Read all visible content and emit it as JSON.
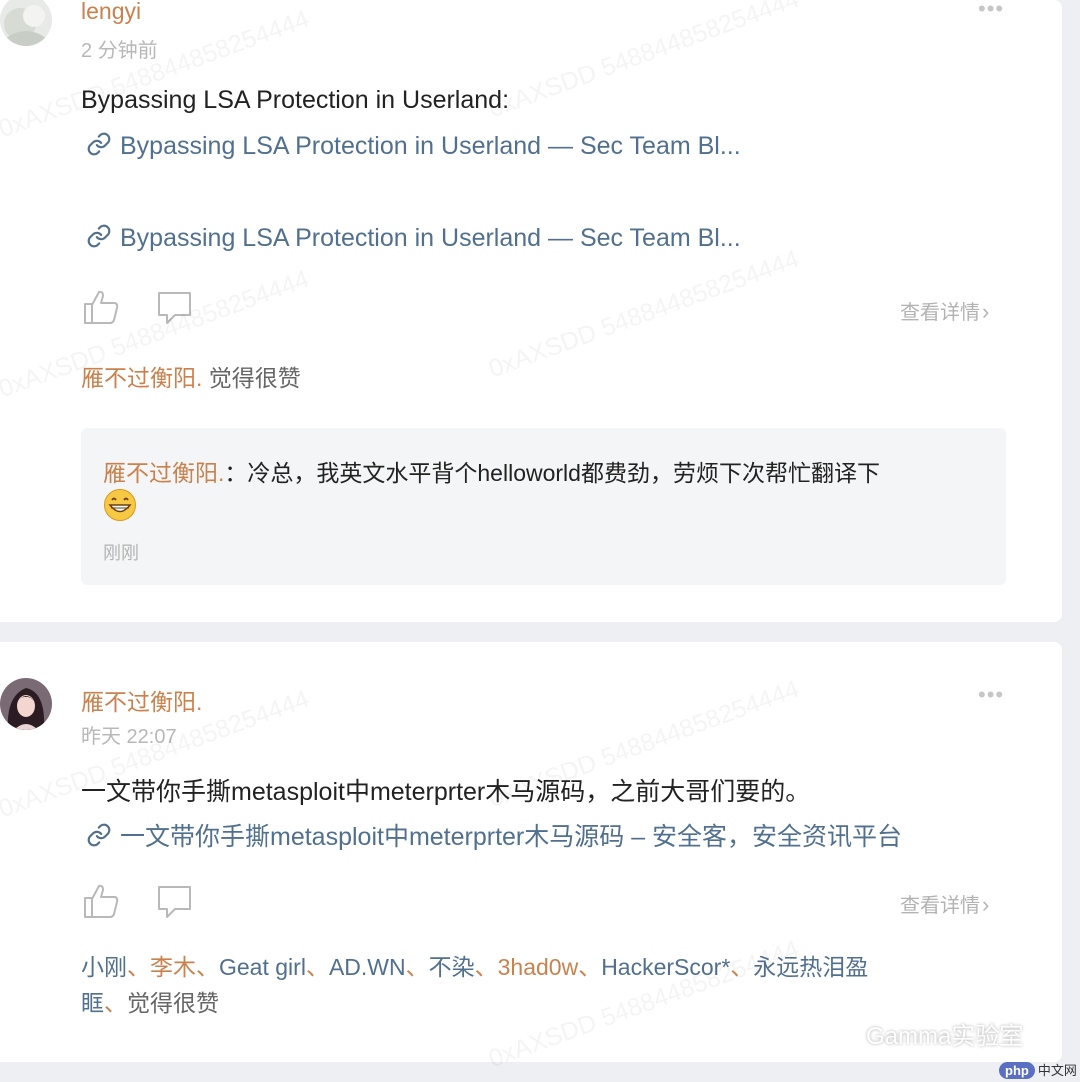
{
  "post1": {
    "author": "lengyi",
    "time": "2 分钟前",
    "text": "Bypassing LSA Protection in Userland:",
    "links": [
      "Bypassing LSA Protection in Userland — Sec Team Bl...",
      "Bypassing LSA Protection in Userland — Sec Team Bl..."
    ],
    "detail_label": "查看详情",
    "like_user": "雁不过衡阳.",
    "like_suffix": "觉得很赞",
    "reply": {
      "author": "雁不过衡阳.",
      "text": "：冷总，我英文水平背个helloworld都费劲，劳烦下次帮忙翻译下",
      "time": "刚刚"
    }
  },
  "post2": {
    "author": "雁不过衡阳.",
    "time": "昨天 22:07",
    "text": "一文带你手撕metasploit中meterprter木马源码，之前大哥们要的。",
    "link": "一文带你手撕metasploit中meterprter木马源码 – 安全客，安全资讯平台",
    "detail_label": "查看详情",
    "likers_line1": [
      {
        "name": "小刚",
        "sep": "、"
      },
      {
        "name": "李木",
        "sep": "、"
      },
      {
        "name": "Geat girl",
        "sep": "、"
      },
      {
        "name": "AD.WN",
        "sep": "、"
      },
      {
        "name": "不染",
        "sep": "、"
      },
      {
        "name": "3had0w",
        "sep": "、"
      },
      {
        "name": "HackerScor*",
        "sep": "、"
      },
      {
        "name": "永远热泪盈",
        "sep": ""
      }
    ],
    "likers_line2_name": "眶",
    "likers_line2_sep": "、",
    "likers_suffix": "觉得很赞"
  },
  "more_label": "•••",
  "watermark": "0xAXSDD 548844858254444",
  "logo_text": "Gamma实验室",
  "site_badge": "php",
  "site_text": "中文网",
  "colors": {
    "name": "#c9824e",
    "link": "#51708f",
    "background": "#eeeff2"
  }
}
